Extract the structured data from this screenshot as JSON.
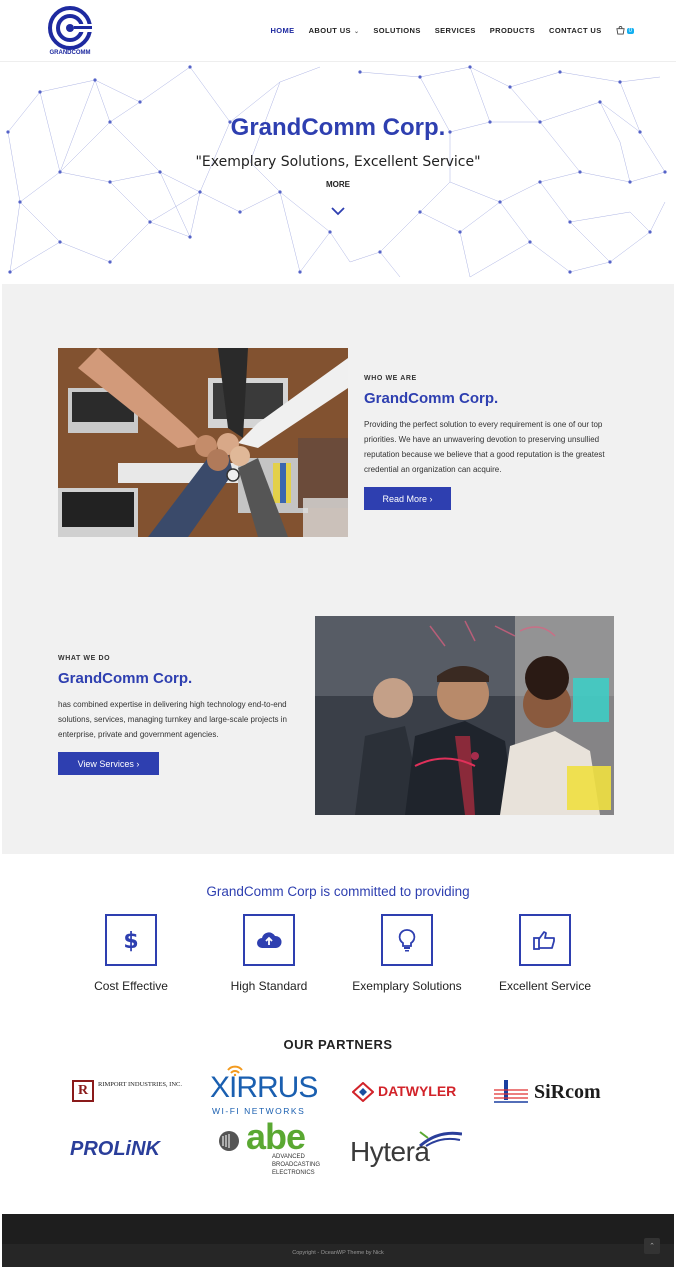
{
  "header": {
    "logo_text": "GRANDCOMM",
    "nav": [
      {
        "label": "HOME",
        "active": true
      },
      {
        "label": "ABOUT US",
        "active": false
      },
      {
        "label": "SOLUTIONS",
        "active": false
      },
      {
        "label": "SERVICES",
        "active": false
      },
      {
        "label": "PRODUCTS",
        "active": false
      },
      {
        "label": "CONTACT US",
        "active": false
      }
    ],
    "cart_count": "0"
  },
  "hero": {
    "title": "GrandComm Corp.",
    "subtitle": "\"Exemplary Solutions, Excellent Service\"",
    "more": "MORE"
  },
  "who": {
    "eyebrow": "WHO WE ARE",
    "title": "GrandComm Corp.",
    "text": "Providing the perfect solution to every requirement is one of our top priorities. We have an unwavering devotion to preserving unsullied reputation because we believe that a good reputation is the greatest credential an organization can acquire.",
    "button": "Read More ›"
  },
  "what": {
    "eyebrow": "WHAT WE DO",
    "title": "GrandComm Corp.",
    "text": "has combined expertise in delivering high technology end-to-end solutions, services, managing turnkey and large-scale projects in enterprise, private and government agencies.",
    "button": "View Services ›"
  },
  "committed": "GrandComm Corp is committed to providing",
  "features": [
    {
      "label": "Cost Effective",
      "icon": "dollar-icon"
    },
    {
      "label": "High Standard",
      "icon": "cloud-upload-icon"
    },
    {
      "label": "Exemplary Solutions",
      "icon": "lightbulb-icon"
    },
    {
      "label": "Excellent Service",
      "icon": "thumbs-up-icon"
    }
  ],
  "partners_title": "OUR PARTNERS",
  "partners": {
    "rimport": "RIMPORT INDUSTRIES, INC.",
    "rimport_mark": "R",
    "xirrus": "XIRRUS",
    "xirrus_sub": "WI-FI NETWORKS",
    "datwyler": "DATWYLER",
    "sircom": "SiRcom",
    "prolink": "PROLiNK",
    "abe": "abe",
    "abe_sub1": "ADVANCED",
    "abe_sub2": "BROADCASTING",
    "abe_sub3": "ELECTRONICS",
    "hytera": "Hytera"
  },
  "footer": {
    "copyright": "Copyright - OceanWP Theme by Nick",
    "to_top": "⌃"
  },
  "colors": {
    "brand_blue": "#2e3fb0",
    "section_gray": "#f1f1f1",
    "footer_dark": "#1e1e1e"
  }
}
